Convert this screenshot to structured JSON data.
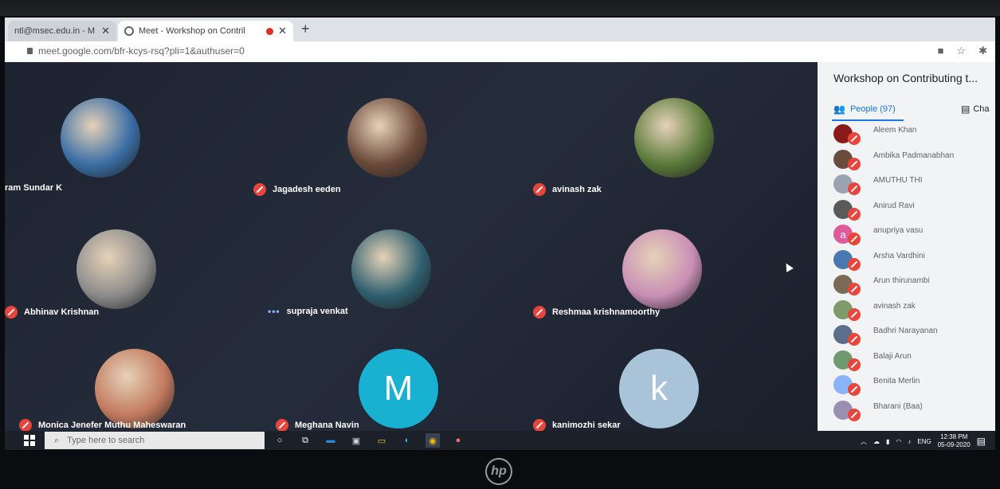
{
  "browser": {
    "tabs": [
      {
        "title": "ntl@msec.edu.in - M"
      },
      {
        "title": "Meet - Workshop on Contril"
      }
    ],
    "url": "meet.google.com/bfr-kcys-rsq?pli=1&authuser=0"
  },
  "meet": {
    "tiles": [
      {
        "name": "ram Sundar K",
        "status": "none",
        "avatar": "photo-circle",
        "color": "#3a6ea5"
      },
      {
        "name": "Jagadesh eeden",
        "status": "muted",
        "avatar": "photo-circle",
        "color": "#6b4a3a"
      },
      {
        "name": "avinash zak",
        "status": "muted",
        "avatar": "photo-circle",
        "color": "#5b7a3a"
      },
      {
        "name": "Abhinav Krishnan",
        "status": "muted",
        "avatar": "photo-circle",
        "color": "#8c8c8c"
      },
      {
        "name": "supraja venkat",
        "status": "speaking",
        "avatar": "photo-circle",
        "color": "#2f5f6e"
      },
      {
        "name": "Reshmaa krishnamoorthy",
        "status": "muted",
        "avatar": "photo-circle",
        "color": "#c98fb5"
      },
      {
        "name": "Monica Jenefer Muthu Maheswaran",
        "status": "muted",
        "avatar": "photo-circle",
        "color": "#c27a5e"
      },
      {
        "name": "Meghana Navin",
        "status": "muted",
        "avatar": "letter",
        "letter": "M",
        "color": "#19b1d1"
      },
      {
        "name": "kanimozhi sekar",
        "status": "muted",
        "avatar": "letter",
        "letter": "k",
        "color": "#a9c4d9"
      }
    ]
  },
  "panel": {
    "title": "Workshop on Contributing t...",
    "people_tab": "People (97)",
    "chat_tab": "Cha",
    "people": [
      {
        "name": "Aleem Khan",
        "color": "#8b1a1a"
      },
      {
        "name": "Ambika Padmanabhan",
        "color": "#6b4b3b"
      },
      {
        "name": "AMUTHU THI",
        "color": "#9aa3b0"
      },
      {
        "name": "Anirud Ravi",
        "color": "#5a5a5a"
      },
      {
        "name": "anupriya vasu",
        "color": "#e05a9b",
        "letter": "a"
      },
      {
        "name": "Arsha Vardhini",
        "color": "#4a78b0"
      },
      {
        "name": "Arun thirunambi",
        "color": "#7b6a55"
      },
      {
        "name": "avinash zak",
        "color": "#7d9c6a"
      },
      {
        "name": "Badhri Narayanan",
        "color": "#5b6f8c"
      },
      {
        "name": "Balaji Arun",
        "color": "#6f9a6f"
      },
      {
        "name": "Benita Merlin",
        "color": "#8ab4f8"
      },
      {
        "name": "Bharani (Baa)",
        "color": "#9a8fb0"
      }
    ]
  },
  "taskbar": {
    "search_placeholder": "Type here to search",
    "lang": "ENG",
    "time": "12:38 PM",
    "date": "05-09-2020"
  },
  "laptop": {
    "logo": "hp"
  }
}
